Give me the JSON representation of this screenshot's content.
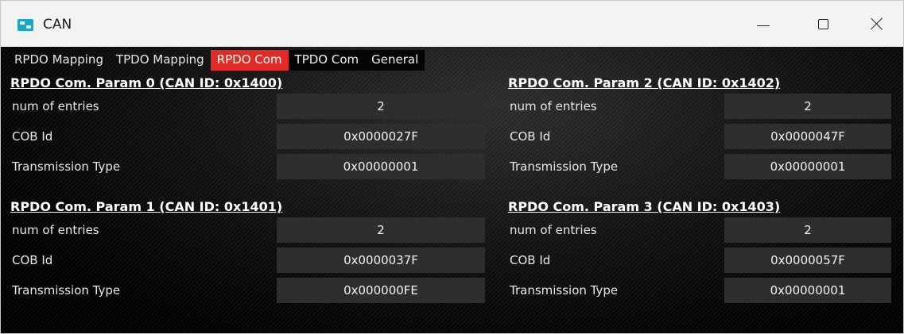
{
  "window": {
    "title": "CAN"
  },
  "tabs": [
    {
      "label": "RPDO Mapping"
    },
    {
      "label": "TPDO Mapping"
    },
    {
      "label": "RPDO Com"
    },
    {
      "label": "TPDO Com"
    },
    {
      "label": "General"
    }
  ],
  "active_tab": "RPDO Com",
  "colors": {
    "active_tab": "#e32b26",
    "value_box": "#2e2e2e",
    "background": "#000000"
  },
  "params": [
    {
      "title": "RPDO Com. Param 0 (CAN ID: 0x1400)",
      "rows": [
        {
          "label": "num of entries",
          "value": "2"
        },
        {
          "label": "COB Id",
          "value": "0x0000027F"
        },
        {
          "label": "Transmission Type",
          "value": "0x00000001"
        }
      ]
    },
    {
      "title": "RPDO Com. Param 1 (CAN ID: 0x1401)",
      "rows": [
        {
          "label": "num of entries",
          "value": "2"
        },
        {
          "label": "COB Id",
          "value": "0x0000037F"
        },
        {
          "label": "Transmission Type",
          "value": "0x000000FE"
        }
      ]
    },
    {
      "title": "RPDO Com. Param 2 (CAN ID: 0x1402)",
      "rows": [
        {
          "label": "num of entries",
          "value": "2"
        },
        {
          "label": "COB Id",
          "value": "0x0000047F"
        },
        {
          "label": "Transmission Type",
          "value": "0x00000001"
        }
      ]
    },
    {
      "title": "RPDO Com. Param 3 (CAN ID: 0x1403)",
      "rows": [
        {
          "label": "num of entries",
          "value": "2"
        },
        {
          "label": "COB Id",
          "value": "0x0000057F"
        },
        {
          "label": "Transmission Type",
          "value": "0x00000001"
        }
      ]
    }
  ]
}
